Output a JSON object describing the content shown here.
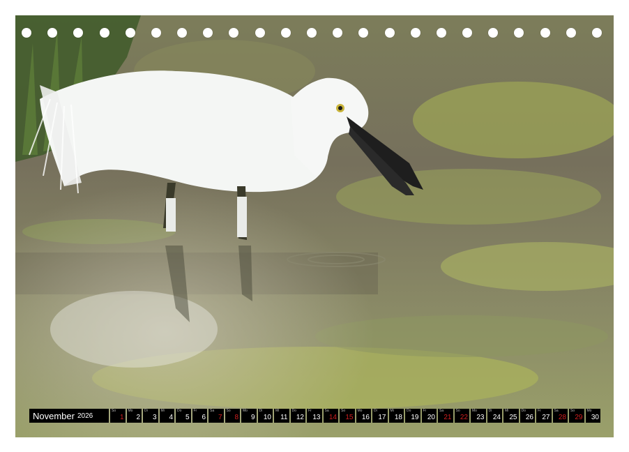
{
  "calendar": {
    "month": "November",
    "year": "2026",
    "days": [
      {
        "wd": "So",
        "num": "1",
        "weekend": true
      },
      {
        "wd": "Mo",
        "num": "2",
        "weekend": false
      },
      {
        "wd": "Di",
        "num": "3",
        "weekend": false
      },
      {
        "wd": "Mi",
        "num": "4",
        "weekend": false
      },
      {
        "wd": "Do",
        "num": "5",
        "weekend": false
      },
      {
        "wd": "Fr",
        "num": "6",
        "weekend": false
      },
      {
        "wd": "Sa",
        "num": "7",
        "weekend": true
      },
      {
        "wd": "So",
        "num": "8",
        "weekend": true
      },
      {
        "wd": "Mo",
        "num": "9",
        "weekend": false
      },
      {
        "wd": "Di",
        "num": "10",
        "weekend": false
      },
      {
        "wd": "Mi",
        "num": "11",
        "weekend": false
      },
      {
        "wd": "Do",
        "num": "12",
        "weekend": false
      },
      {
        "wd": "Fr",
        "num": "13",
        "weekend": false
      },
      {
        "wd": "Sa",
        "num": "14",
        "weekend": true
      },
      {
        "wd": "So",
        "num": "15",
        "weekend": true
      },
      {
        "wd": "Mo",
        "num": "16",
        "weekend": false
      },
      {
        "wd": "Di",
        "num": "17",
        "weekend": false
      },
      {
        "wd": "Mi",
        "num": "18",
        "weekend": false
      },
      {
        "wd": "Do",
        "num": "19",
        "weekend": false
      },
      {
        "wd": "Fr",
        "num": "20",
        "weekend": false
      },
      {
        "wd": "Sa",
        "num": "21",
        "weekend": true
      },
      {
        "wd": "So",
        "num": "22",
        "weekend": true
      },
      {
        "wd": "Mo",
        "num": "23",
        "weekend": false
      },
      {
        "wd": "Di",
        "num": "24",
        "weekend": false
      },
      {
        "wd": "Mi",
        "num": "25",
        "weekend": false
      },
      {
        "wd": "Do",
        "num": "26",
        "weekend": false
      },
      {
        "wd": "Fr",
        "num": "27",
        "weekend": false
      },
      {
        "wd": "Sa",
        "num": "28",
        "weekend": true
      },
      {
        "wd": "So",
        "num": "29",
        "weekend": true
      },
      {
        "wd": "Mo",
        "num": "30",
        "weekend": false
      }
    ]
  },
  "binding": {
    "hole_count": 23
  },
  "colors": {
    "weekend_number": "#d21f1f",
    "bar_background": "#000000",
    "water": "#6e6a58",
    "algae": "#a8b25e",
    "egret": "#f4f6f4"
  }
}
